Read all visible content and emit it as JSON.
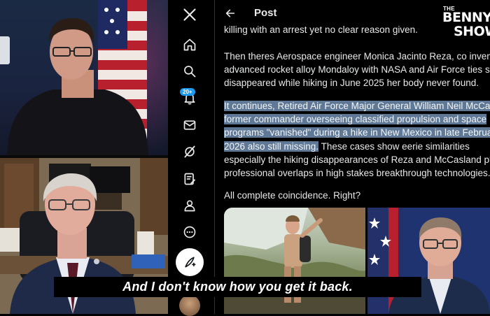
{
  "nav": {
    "notifications_badge": "20+"
  },
  "post": {
    "header_title": "Post",
    "paragraphs": [
      {
        "lines": [
          {
            "segments": [
              {
                "text": "killing with an arrest yet no clear reason given.",
                "hl": false
              }
            ]
          }
        ]
      },
      {
        "lines": [
          {
            "segments": [
              {
                "text": "Then theres Aerospace engineer Monica Jacinto Reza,  co invent",
                "hl": false
              }
            ]
          },
          {
            "segments": [
              {
                "text": "advanced rocket alloy Mondaloy with NASA and Air Force ties sh",
                "hl": false
              }
            ]
          },
          {
            "segments": [
              {
                "text": "disappeared while hiking in June 2025 her body never found.",
                "hl": false
              }
            ]
          }
        ]
      },
      {
        "lines": [
          {
            "segments": [
              {
                "text": "It continues,  Retired Air Force Major General William Neil McCas",
                "hl": true
              }
            ]
          },
          {
            "segments": [
              {
                "text": "former commander overseeing classified propulsion and space",
                "hl": true
              }
            ]
          },
          {
            "segments": [
              {
                "text": "programs \"vanished\" during a hike in New Mexico in late Februar",
                "hl": true
              }
            ]
          },
          {
            "segments": [
              {
                "text": "2026 also still missing.",
                "hl": true
              },
              {
                "text": "  These cases show eerie similarities",
                "hl": false
              }
            ]
          },
          {
            "segments": [
              {
                "text": "especially the hiking disappearances of Reza and McCasland plu",
                "hl": false
              }
            ]
          },
          {
            "segments": [
              {
                "text": "professional overlaps in high stakes breakthrough technologies.",
                "hl": false
              }
            ]
          }
        ]
      },
      {
        "lines": [
          {
            "segments": [
              {
                "text": "All complete coincidence. Right?",
                "hl": false
              }
            ]
          }
        ]
      }
    ]
  },
  "logo": {
    "line1": "THE",
    "line2": "BENNY",
    "line3": "SHOW"
  },
  "caption": "And I don't know how you get it back.",
  "colors": {
    "highlight": "#5e7896",
    "accent": "#1d9bf0",
    "text": "#e7e9ea"
  }
}
